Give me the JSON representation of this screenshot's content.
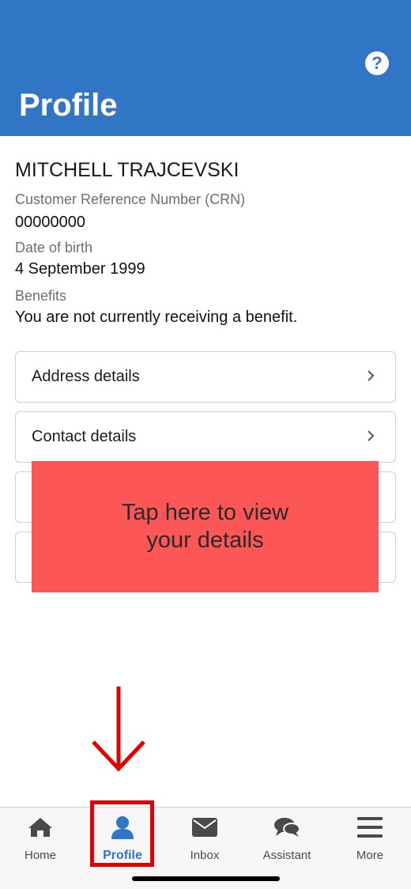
{
  "header": {
    "title": "Profile",
    "help_icon": "question-circle-icon",
    "background": "#3176c5"
  },
  "profile": {
    "name": "MITCHELL TRAJCEVSKI",
    "crn_label": "Customer Reference Number (CRN)",
    "crn_value": "00000000",
    "dob_label": "Date of birth",
    "dob_value": "4 September 1999",
    "benefits_label": "Benefits",
    "benefits_value": "You are not currently receiving a benefit."
  },
  "cards": [
    {
      "label": "Address details"
    },
    {
      "label": "Contact details"
    },
    {
      "label": ""
    },
    {
      "label": ""
    }
  ],
  "overlay": {
    "text": "Tap here to view\nyour details",
    "color": "#fd5656"
  },
  "tabbar": {
    "items": [
      {
        "label": "Home",
        "icon": "home-icon"
      },
      {
        "label": "Profile",
        "icon": "user-icon",
        "active": true
      },
      {
        "label": "Inbox",
        "icon": "envelope-icon"
      },
      {
        "label": "Assistant",
        "icon": "chat-bubbles-icon"
      },
      {
        "label": "More",
        "icon": "hamburger-menu-icon"
      }
    ]
  },
  "annotation_color": "#e30000"
}
